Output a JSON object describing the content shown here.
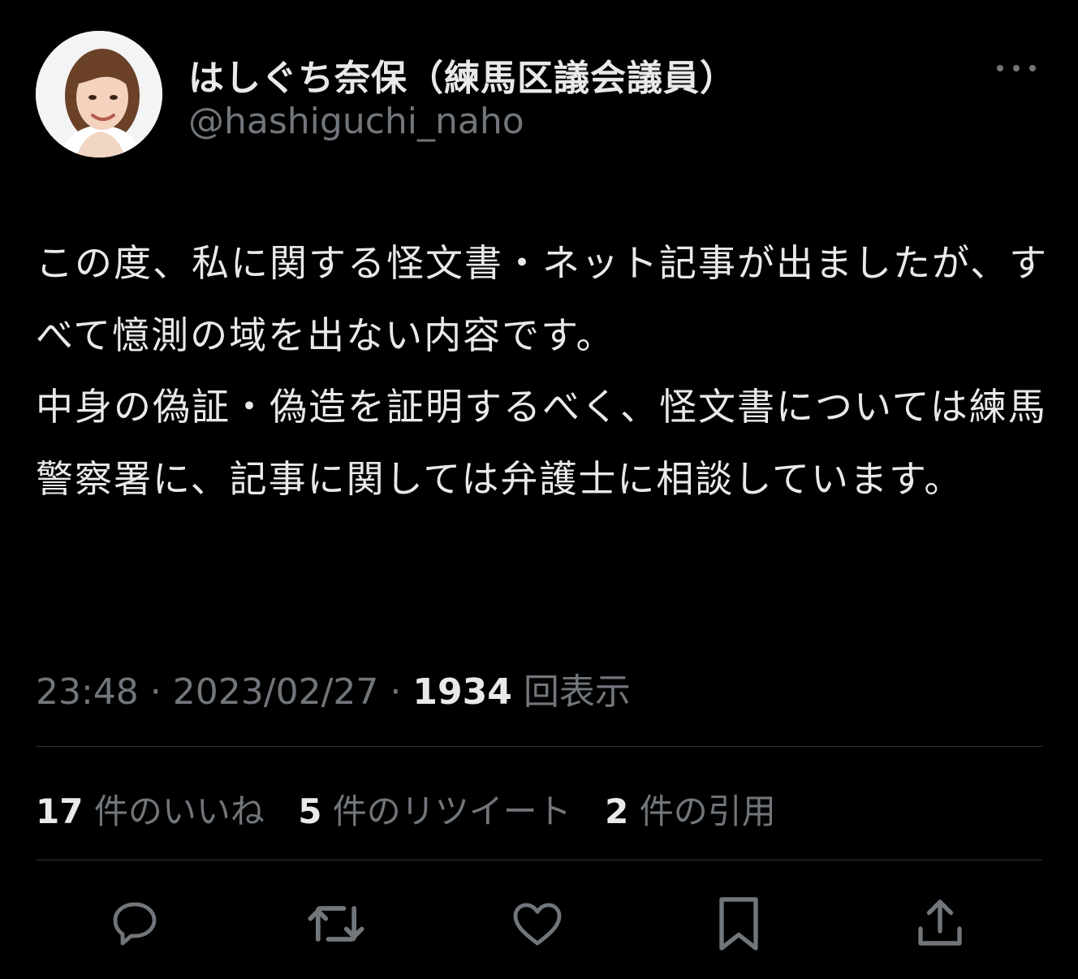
{
  "user": {
    "display_name": "はしぐち奈保（練馬区議会議員）",
    "handle": "@hashiguchi_naho"
  },
  "tweet": {
    "text": "この度、私に関する怪文書・ネット記事が出ましたが、すべて憶測の域を出ない内容です。\n中身の偽証・偽造を証明するべく、怪文書については練馬警察署に、記事に関しては弁護士に相談しています。"
  },
  "meta": {
    "time": "23:48",
    "sep1": " · ",
    "date": "2023/02/27",
    "sep2": " · ",
    "views_count": "1934",
    "views_label": " 回表示"
  },
  "stats": {
    "likes_count": "17",
    "likes_label": "件のいいね",
    "retweets_count": "5",
    "retweets_label": "件のリツイート",
    "quotes_count": "2",
    "quotes_label": "件の引用"
  },
  "icons": {
    "more": "more-icon",
    "reply": "reply-icon",
    "retweet": "retweet-icon",
    "like": "heart-icon",
    "bookmark": "bookmark-icon",
    "share": "share-icon"
  },
  "colors": {
    "background": "#000000",
    "text_primary": "#e7e9ea",
    "text_secondary": "#71767b",
    "divider": "#2f3336"
  }
}
